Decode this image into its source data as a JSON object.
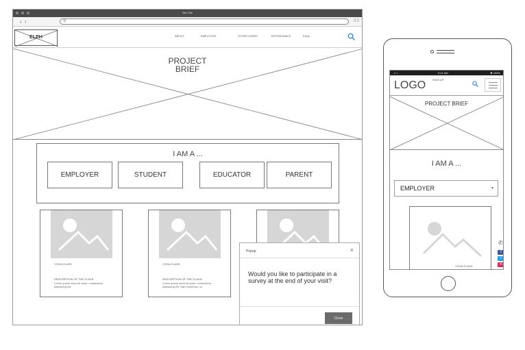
{
  "desktop": {
    "window_title": "Site Title",
    "feed_label": "(( ))",
    "logo": "ELPH",
    "nav": [
      "ABOUT",
      "EMPLOYER",
      "OTHER USERS",
      "TESTIMONIALS",
      "FAQs"
    ],
    "hero_title_line1": "PROJECT",
    "hero_title_line2": "BRIEF",
    "iam_title": "I AM A ...",
    "roles": [
      "EMPLOYER",
      "STUDENT",
      "EDUCATOR",
      "PARENT"
    ],
    "cards": [
      {
        "title": "YOGA CLASS",
        "desc_label": "DESCRIPTION OF THE CLASS:",
        "desc": "Lorem ipsum dolor sit amet, consectetur adipiscing elit."
      },
      {
        "title": "YOGA CLASS",
        "desc_label": "DESCRIPTION OF THE CLASS:",
        "desc": "Lorem ipsum dolor sit amet, consectetur adipiscing elit. Nam maximus, ra."
      },
      {
        "title": "",
        "desc_label": "",
        "desc": ""
      }
    ],
    "popup": {
      "title": "Popup",
      "close_icon": "×",
      "message": "Would you like to participate in a survey at the end of your visit?",
      "button": "Close"
    }
  },
  "mobile": {
    "status_left": "..ıl ≈",
    "status_center": "9:41 AM",
    "status_right": "✱ 100%",
    "logo": "LOGO",
    "signup": "SIGN UP",
    "hero_title": "PROJECT BRIEF",
    "iam_title": "I AM A ...",
    "select_value": "EMPLOYER",
    "card_title": "YOGA CLASS",
    "social": [
      {
        "label": "f",
        "color": "#3b5998"
      },
      {
        "label": "t",
        "color": "#1da1f2"
      },
      {
        "label": "in",
        "color": "#e0245e"
      }
    ]
  },
  "colors": {
    "accent_search": "#4a90d9",
    "titlebar": "#4a4a4a",
    "placeholder_image": "#d6d6d6"
  },
  "icons": {
    "search": "search-icon",
    "menu": "hamburger-menu-icon",
    "phone": "phone-icon",
    "image": "image-placeholder-icon"
  }
}
